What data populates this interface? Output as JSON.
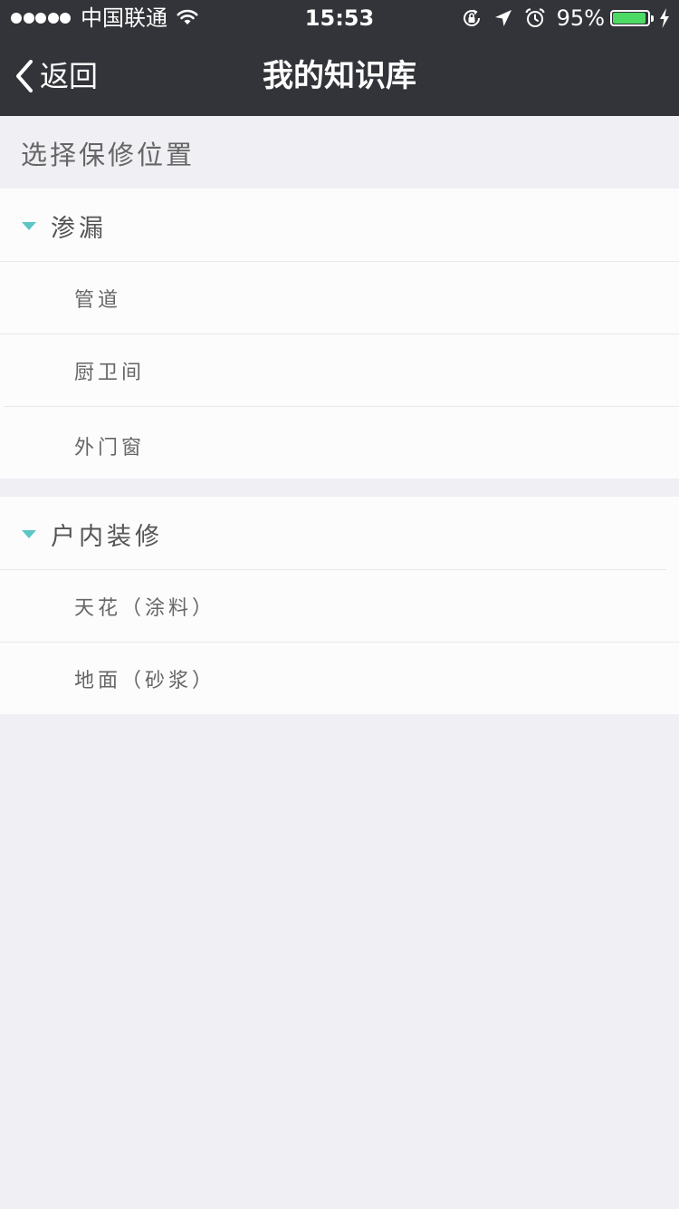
{
  "status_bar": {
    "carrier": "中国联通",
    "time": "15:53",
    "battery_percent_label": "95%",
    "battery_level": 0.95,
    "icons": [
      "signal-dots-icon",
      "wifi-icon",
      "rotation-lock-icon",
      "location-arrow-icon",
      "alarm-icon",
      "battery-icon",
      "charging-bolt-icon"
    ]
  },
  "nav": {
    "back_label": "返回",
    "title": "我的知识库"
  },
  "section_heading": "选择保修位置",
  "groups": [
    {
      "title": "渗漏",
      "items": [
        "管道",
        "厨卫间",
        "外门窗"
      ]
    },
    {
      "title": "户内装修",
      "items": [
        "天花（涂料）",
        "地面（砂浆）"
      ]
    }
  ],
  "colors": {
    "bar_background": "#333439",
    "page_background": "#efeff4",
    "accent_caret": "#5cc6c3",
    "battery_fill": "#4cd964"
  }
}
